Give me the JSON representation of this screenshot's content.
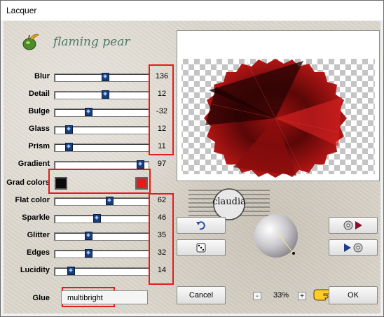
{
  "window": {
    "title": "Lacquer"
  },
  "brand": {
    "name": "flaming pear"
  },
  "sliders": [
    {
      "label": "Blur",
      "value": "136",
      "pos": 0.55
    },
    {
      "label": "Detail",
      "value": "12",
      "pos": 0.55
    },
    {
      "label": "Bulge",
      "value": "-32",
      "pos": 0.35
    },
    {
      "label": "Glass",
      "value": "12",
      "pos": 0.12
    },
    {
      "label": "Prism",
      "value": "11",
      "pos": 0.12
    },
    {
      "label": "Gradient",
      "value": "97",
      "pos": 0.96
    }
  ],
  "grad_colors": {
    "label": "Grad colors",
    "color1": "#0b0b0b",
    "color2": "#e21b1b"
  },
  "sliders2": [
    {
      "label": "Flat color",
      "value": "62",
      "pos": 0.6
    },
    {
      "label": "Sparkle",
      "value": "46",
      "pos": 0.45
    },
    {
      "label": "Glitter",
      "value": "35",
      "pos": 0.35
    },
    {
      "label": "Edges",
      "value": "32",
      "pos": 0.35
    },
    {
      "label": "Lucidity",
      "value": "14",
      "pos": 0.15
    }
  ],
  "glue": {
    "label": "Glue",
    "value": "multibright"
  },
  "buttons": {
    "cancel": "Cancel",
    "ok": "OK"
  },
  "zoom": {
    "value": "33%",
    "minus": "-",
    "plus": "+"
  },
  "watermark": {
    "text": "claudia"
  },
  "colors": {
    "highlight_box": "#e21d1d",
    "thumb": "#1a3d7a"
  }
}
